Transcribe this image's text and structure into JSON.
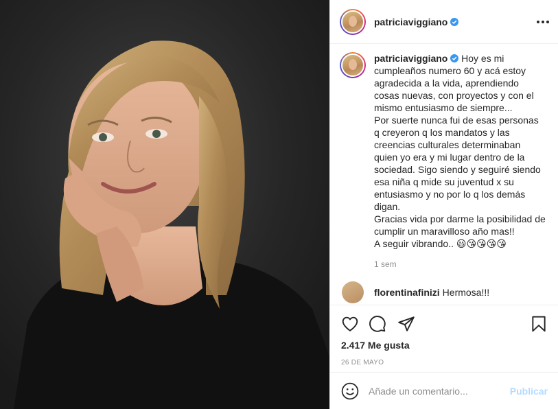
{
  "post": {
    "username": "patriciaviggiano",
    "verified_icon": "verified-badge-icon",
    "more_icon": "more-options-icon"
  },
  "caption": {
    "username": "patriciaviggiano",
    "text": "Hoy es mi cumpleaños numero 60 y acá estoy agradecida a la vida, aprendiendo cosas nuevas, con proyectos y con el mismo entusiasmo de siempre...\nPor suerte nunca fui de esas personas q creyeron q los mandatos y las creencias culturales determinaban quien yo era y mi lugar dentro de la sociedad. Sigo siendo y seguiré siendo esa niña q mide su juventud x su entusiasmo y no por lo q los demás digan.\nGracias vida por darme la posibilidad de cumplir un maravilloso año mas!!\nA seguir vibrando.. 😃😘😘😘😘",
    "time_ago": "1 sem"
  },
  "next_comment": {
    "username": "florentinafinizi",
    "text": "Hermosa!!!"
  },
  "actions": {
    "like_icon": "heart-icon",
    "comment_icon": "comment-icon",
    "share_icon": "share-icon",
    "save_icon": "bookmark-icon",
    "likes": "2.417 Me gusta",
    "date": "26 DE MAYO"
  },
  "comment_box": {
    "emoji_icon": "emoji-icon",
    "placeholder": "Añade un comentario...",
    "publish": "Publicar"
  },
  "colors": {
    "accent_blue": "#0095f6",
    "publish_disabled": "#b3dbff",
    "secondary_text": "#8e8e8e"
  }
}
